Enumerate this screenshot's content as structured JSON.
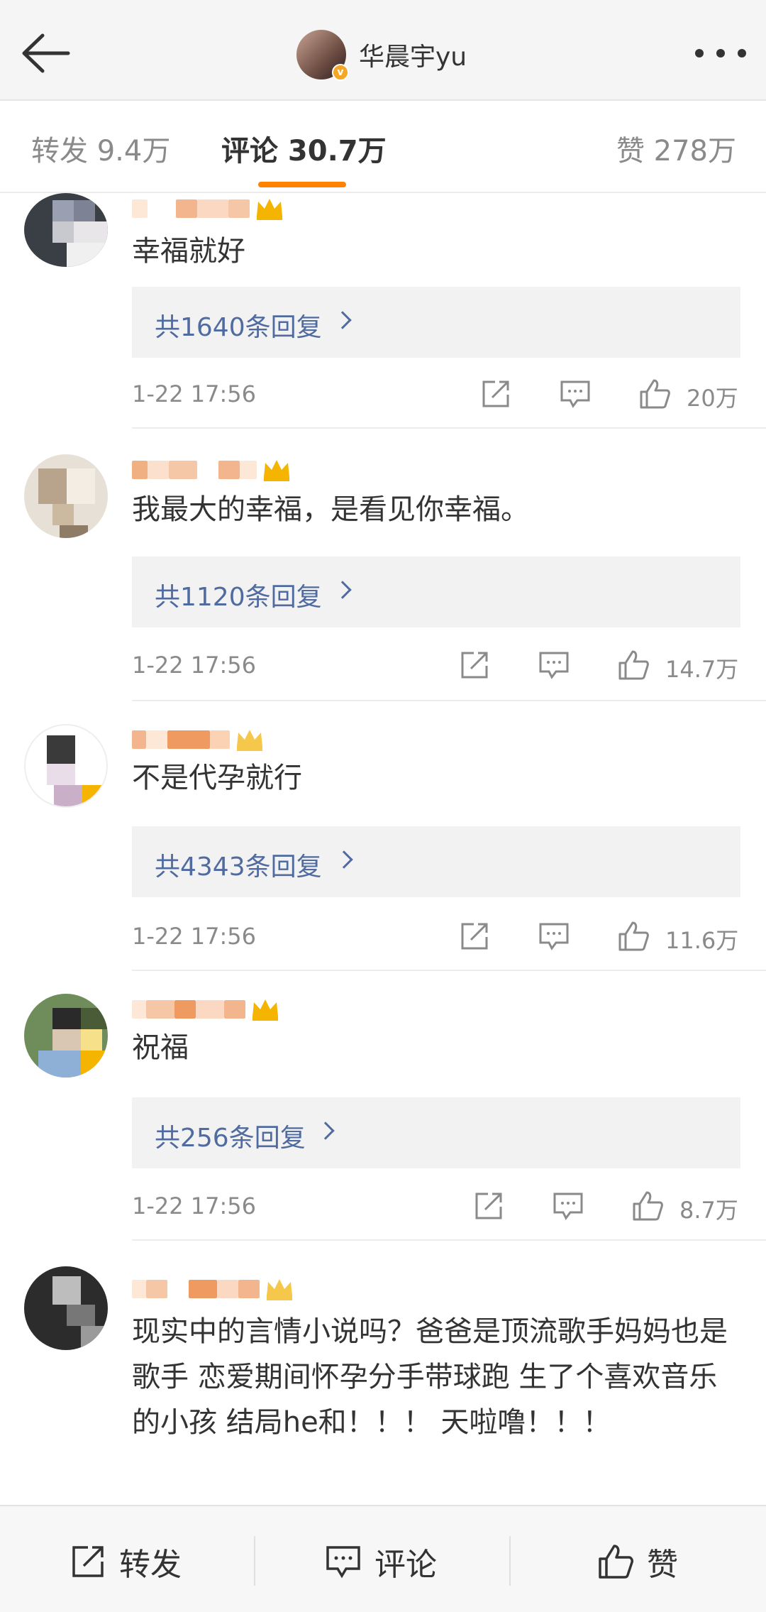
{
  "header": {
    "title": "华晨宇yu",
    "verified_badge": "v"
  },
  "tabs": {
    "repost": "转发 9.4万",
    "comment": "评论 30.7万",
    "like": "赞 278万"
  },
  "comments": [
    {
      "text": "幸福就好",
      "replies": "共1640条回复",
      "time": "1-22 17:56",
      "likes": "20万"
    },
    {
      "text": "我最大的幸福，是看见你幸福。",
      "replies": "共1120条回复",
      "time": "1-22 17:56",
      "likes": "14.7万"
    },
    {
      "text": "不是代孕就行",
      "replies": "共4343条回复",
      "time": "1-22 17:56",
      "likes": "11.6万"
    },
    {
      "text": "祝福",
      "replies": "共256条回复",
      "time": "1-22 17:56",
      "likes": "8.7万"
    },
    {
      "text": "现实中的言情小说吗？爸爸是顶流歌手妈妈也是歌手 恋爱期间怀孕分手带球跑 生了个喜欢音乐的小孩 结局he和！！！ 天啦噜！！！"
    }
  ],
  "bottom_bar": {
    "repost": "转发",
    "comment": "评论",
    "like": "赞"
  },
  "colors": {
    "accent": "#ff8200",
    "link": "#506b9f",
    "muted": "#8a8a8a"
  },
  "icons": [
    "back-arrow-icon",
    "more-icon",
    "share-icon",
    "comment-icon",
    "thumb-up-icon",
    "crown-icon"
  ]
}
